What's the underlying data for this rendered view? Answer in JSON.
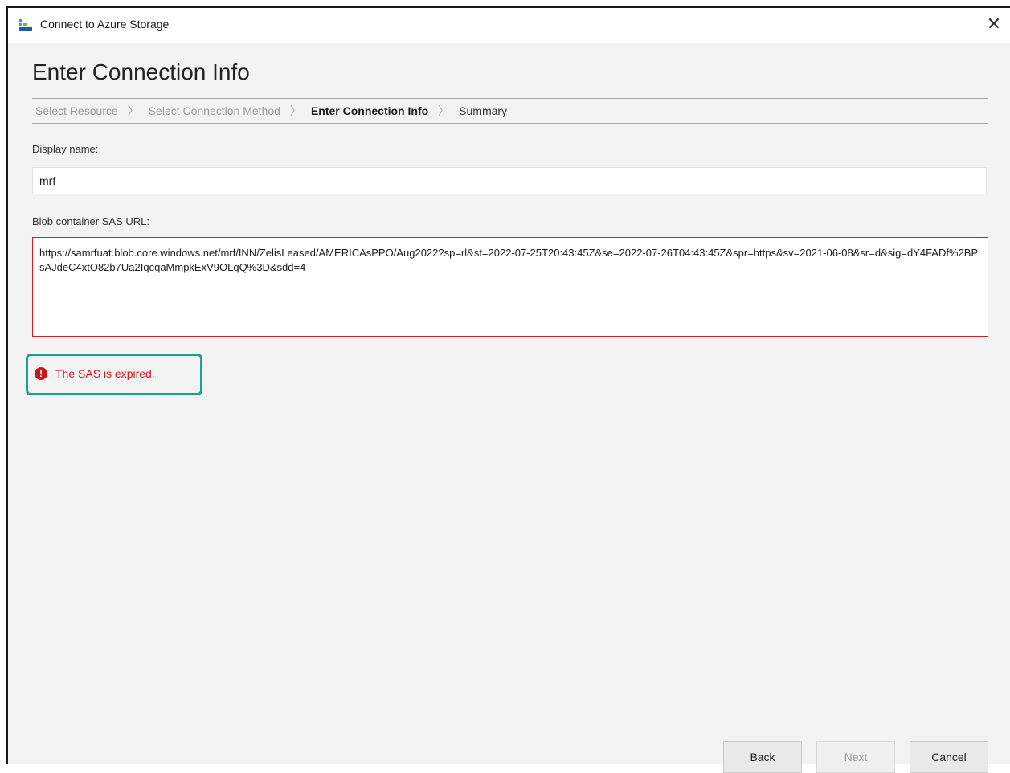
{
  "window": {
    "title": "Connect to Azure Storage"
  },
  "page": {
    "heading": "Enter Connection Info"
  },
  "breadcrumb": {
    "items": [
      {
        "label": "Select Resource",
        "state": "disabled"
      },
      {
        "label": "Select Connection Method",
        "state": "disabled"
      },
      {
        "label": "Enter Connection Info",
        "state": "active"
      },
      {
        "label": "Summary",
        "state": "normal"
      }
    ]
  },
  "form": {
    "display_name_label": "Display name:",
    "display_name_value": "mrf",
    "sas_label": "Blob container SAS URL:",
    "sas_value": "https://samrfuat.blob.core.windows.net/mrf/INN/ZelisLeased/AMERICAsPPO/Aug2022?sp=rl&st=2022-07-25T20:43:45Z&se=2022-07-26T04:43:45Z&spr=https&sv=2021-06-08&sr=d&sig=dY4FADf%2BPsAJdeC4xtO82b7Ua2IqcqaMmpkExV9OLqQ%3D&sdd=4"
  },
  "error": {
    "message": "The SAS is expired.",
    "icon": "error-exclamation-icon"
  },
  "buttons": {
    "back": "Back",
    "next": "Next",
    "cancel": "Cancel"
  },
  "colors": {
    "error": "#c8181e",
    "highlight": "#1aa38a",
    "invalid_border": "#d21f1f"
  }
}
